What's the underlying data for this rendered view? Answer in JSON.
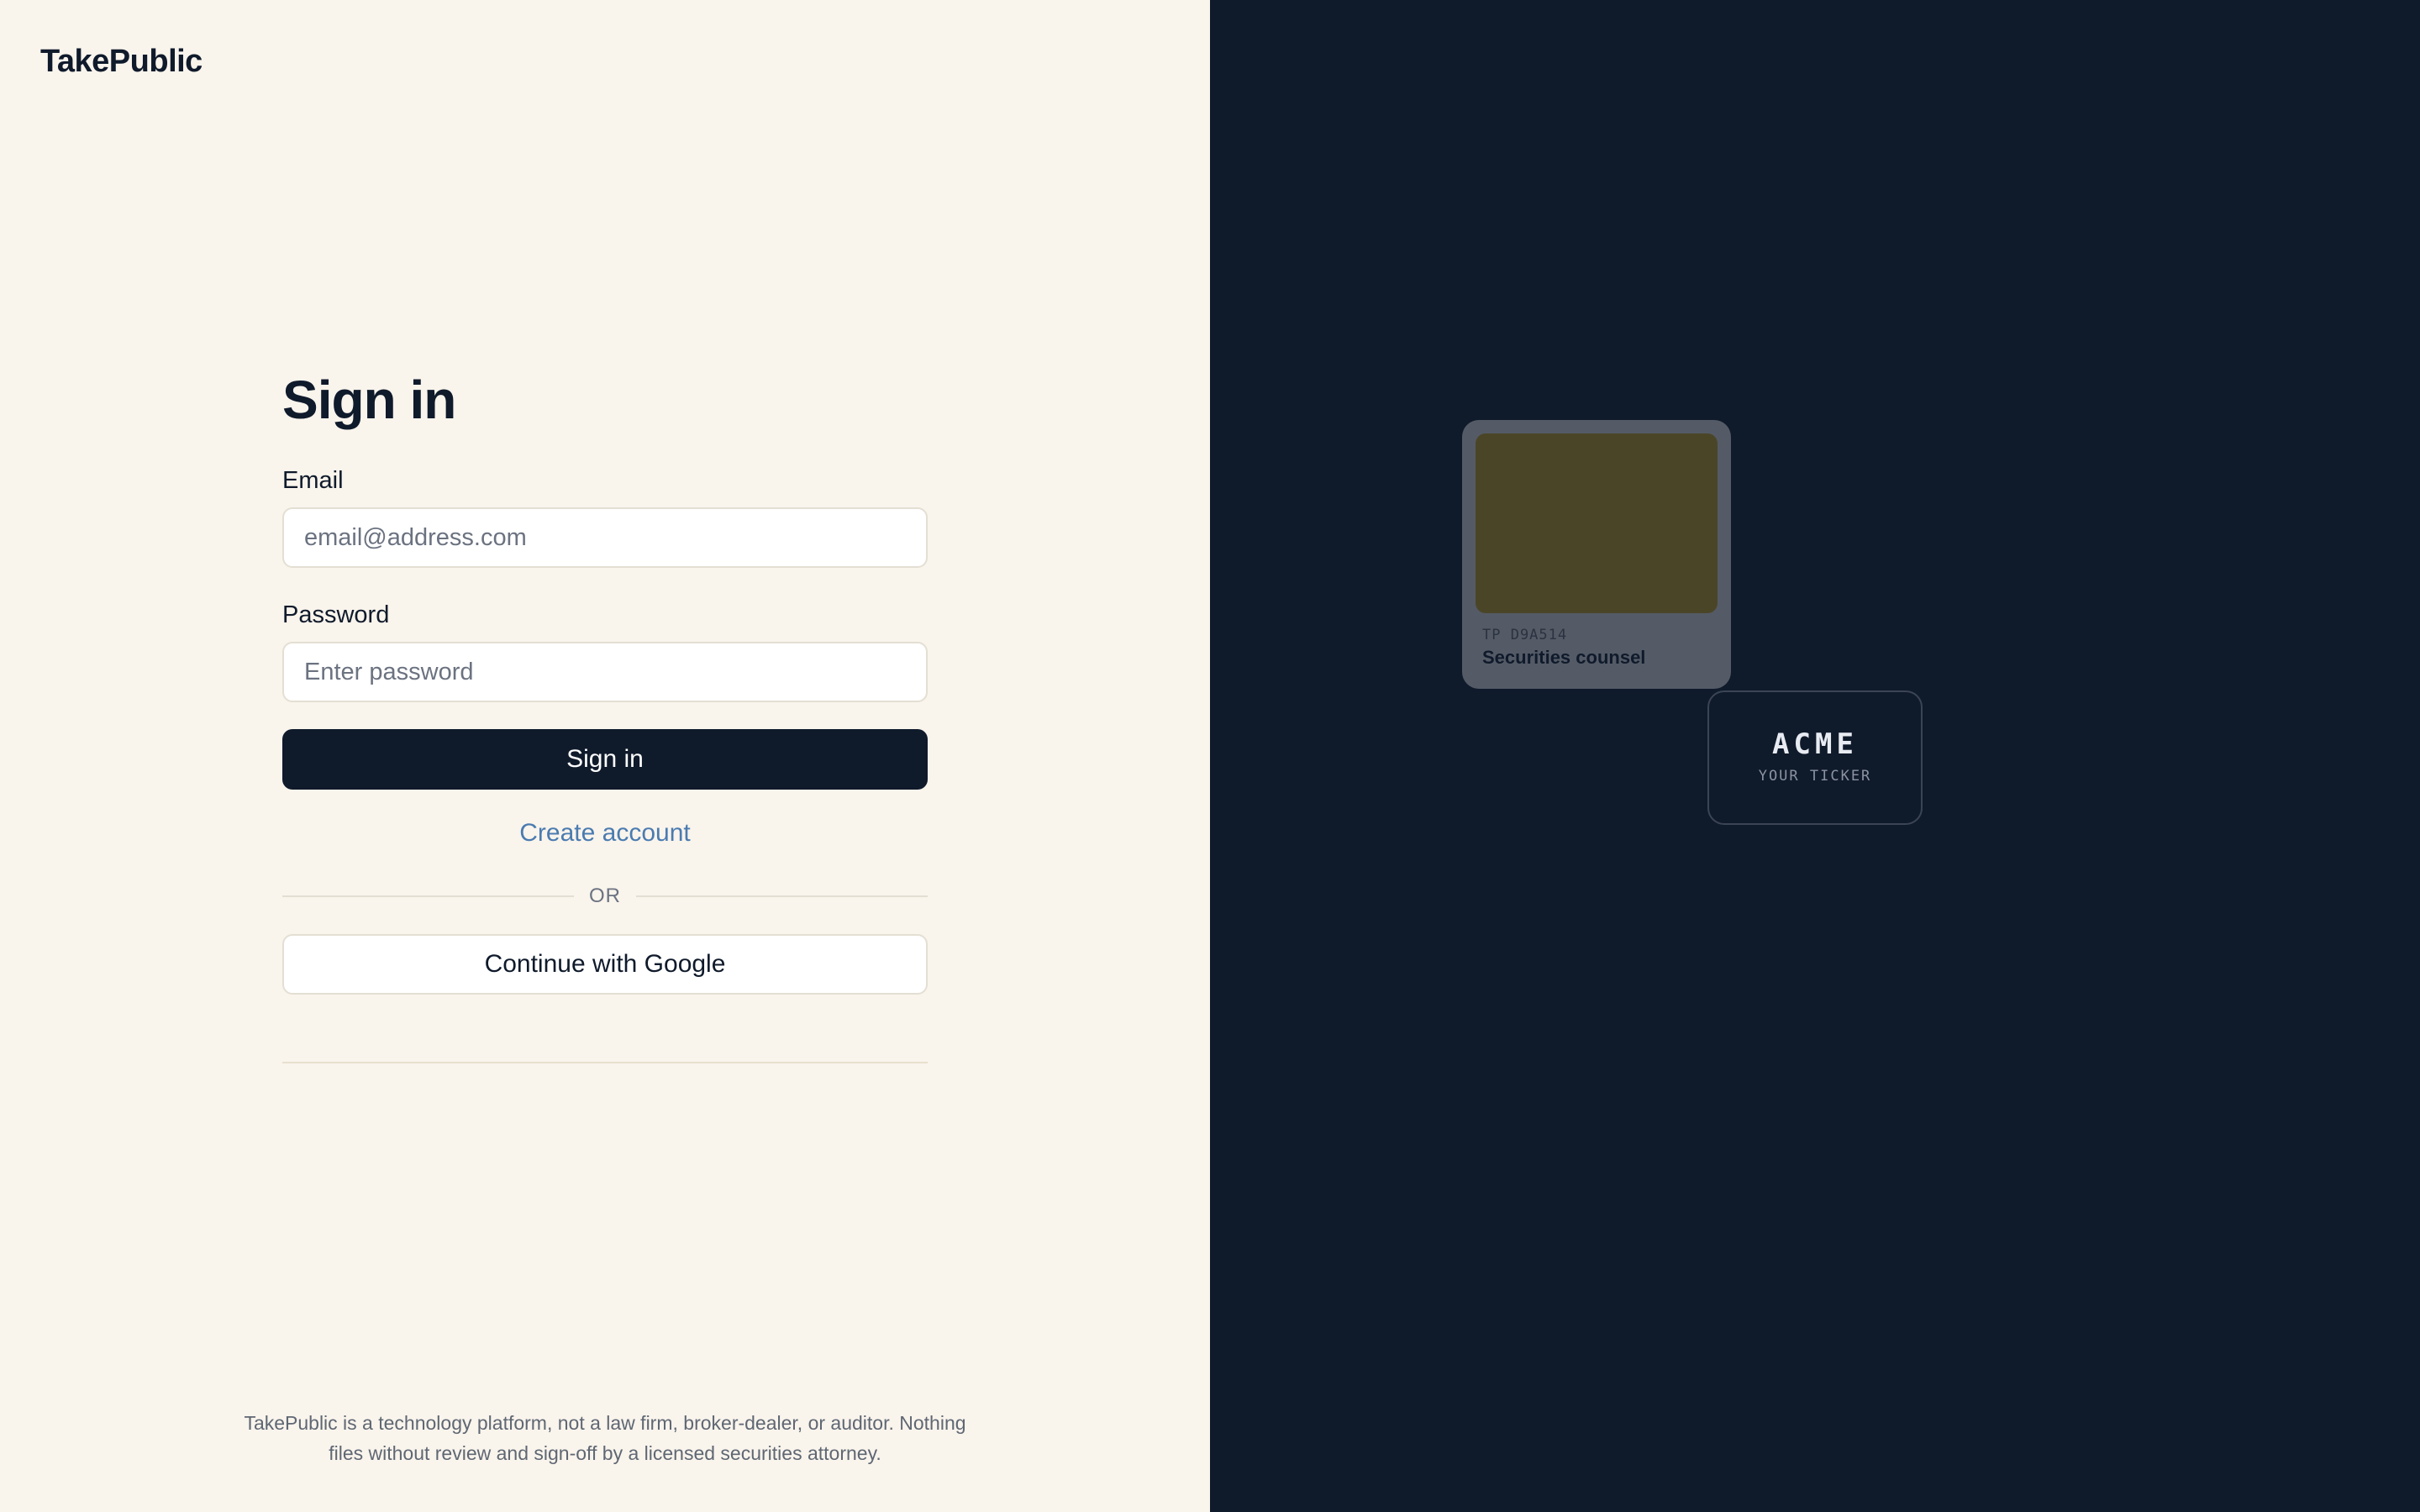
{
  "brand": {
    "name": "TakePublic"
  },
  "signin": {
    "title": "Sign in",
    "email_label": "Email",
    "email_placeholder": "email@address.com",
    "email_value": "",
    "password_label": "Password",
    "password_placeholder": "Enter password",
    "password_value": "",
    "submit_label": "Sign in",
    "create_account_label": "Create account",
    "divider_label": "OR",
    "google_label": "Continue with Google"
  },
  "footer": {
    "disclaimer_line1": "TakePublic is a technology platform, not a law firm, broker-dealer, or auditor. Nothing",
    "disclaimer_line2": "files without review and sign-off by a licensed securities attorney."
  },
  "showcase": {
    "counsel_card": {
      "code": "TP D9A514",
      "role": "Securities counsel"
    },
    "ticker_card": {
      "symbol": "ACME",
      "caption": "YOUR TICKER"
    }
  },
  "colors": {
    "left_background": "#f9f4ec",
    "right_background": "#0f1a2b",
    "primary": "#0f1a2b",
    "link": "#4a7bb0"
  }
}
